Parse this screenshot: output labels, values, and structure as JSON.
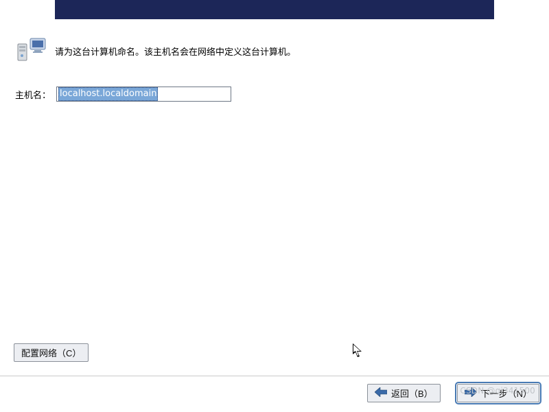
{
  "header": {},
  "hint": {
    "text": "请为这台计算机命名。该主机名会在网络中定义这台计算机。"
  },
  "hostname": {
    "label": "主机名：",
    "value": "localhost.localdomain"
  },
  "buttons": {
    "configure_network": "配置网络（C）",
    "back": "返回（B）",
    "next": "下一步（N）"
  },
  "watermark": "CSDN @qi341500"
}
